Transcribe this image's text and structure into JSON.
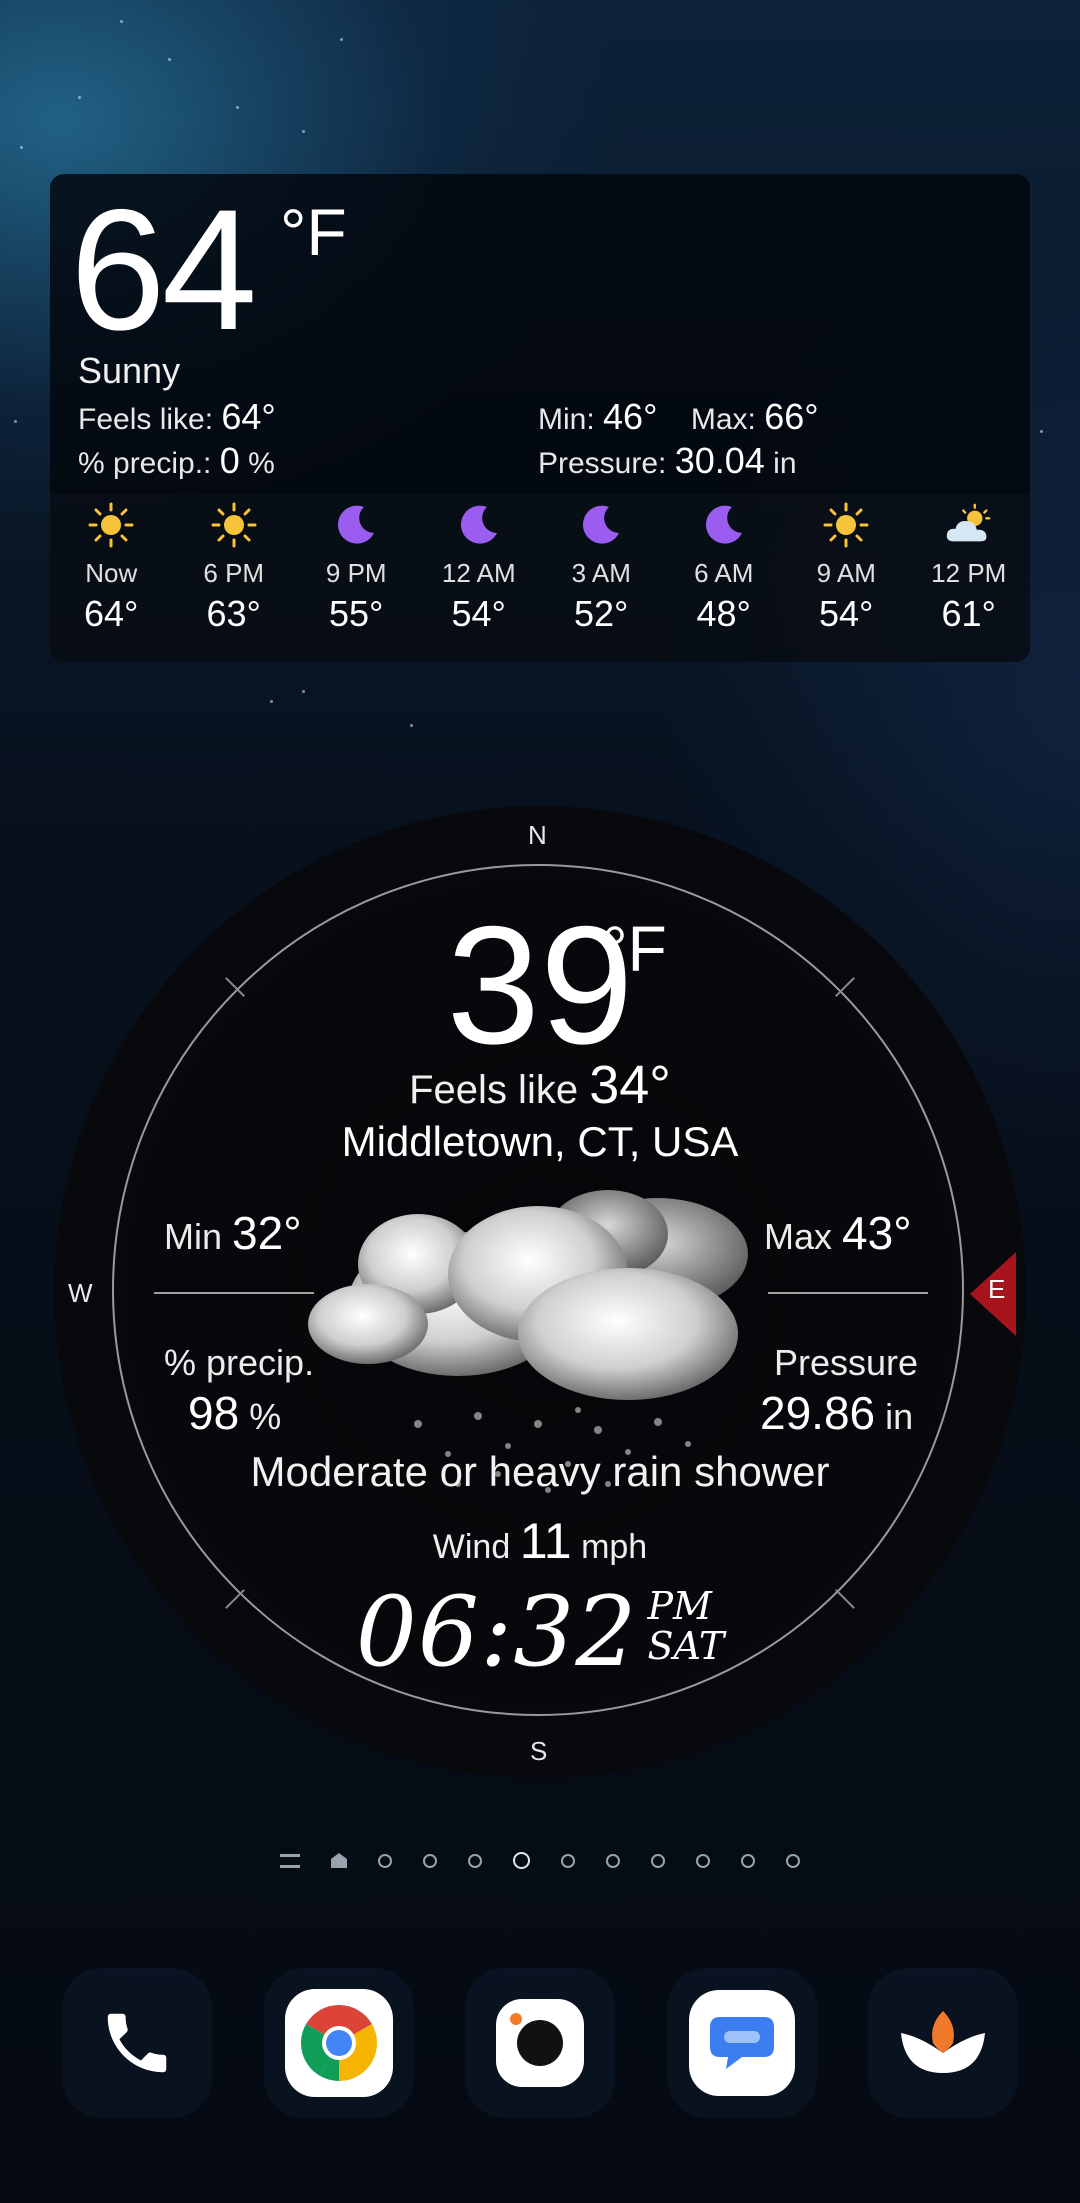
{
  "top_widget": {
    "temp": "64",
    "unit": "°F",
    "condition": "Sunny",
    "feels_label": "Feels like:",
    "feels_value": "64°",
    "precip_label": "% precip.:",
    "precip_value": "0",
    "precip_unit": "%",
    "min_label": "Min:",
    "min_value": "46°",
    "max_label": "Max:",
    "max_value": "66°",
    "pressure_label": "Pressure:",
    "pressure_value": "30.04",
    "pressure_unit": "in",
    "hourly": [
      {
        "time": "Now",
        "temp": "64°",
        "icon": "sun-icon"
      },
      {
        "time": "6 PM",
        "temp": "63°",
        "icon": "sun-icon"
      },
      {
        "time": "9 PM",
        "temp": "55°",
        "icon": "moon-icon"
      },
      {
        "time": "12 AM",
        "temp": "54°",
        "icon": "moon-icon"
      },
      {
        "time": "3 AM",
        "temp": "52°",
        "icon": "moon-icon"
      },
      {
        "time": "6 AM",
        "temp": "48°",
        "icon": "moon-icon"
      },
      {
        "time": "9 AM",
        "temp": "54°",
        "icon": "sun-icon"
      },
      {
        "time": "12 PM",
        "temp": "61°",
        "icon": "partly-cloudy-icon"
      }
    ]
  },
  "compass_widget": {
    "north": "N",
    "south": "S",
    "west": "W",
    "east": "E",
    "temp": "39",
    "unit": "°F",
    "feels_label": "Feels like",
    "feels_value": "34°",
    "location": "Middletown, CT, USA",
    "min_label": "Min",
    "min_value": "32°",
    "max_label": "Max",
    "max_value": "43°",
    "precip_label": "% precip.",
    "precip_value": "98",
    "precip_unit": "%",
    "pressure_label": "Pressure",
    "pressure_value": "29.86",
    "pressure_unit": "in",
    "description": "Moderate or heavy rain shower",
    "wind_label": "Wind",
    "wind_value": "11",
    "wind_unit": "mph",
    "time": "06:32",
    "ampm": "PM",
    "day": "SAT"
  },
  "pager": {
    "pages": 10,
    "active_index": 3
  },
  "dock": [
    {
      "name": "phone",
      "icon": "phone-icon"
    },
    {
      "name": "chrome",
      "icon": "chrome-icon"
    },
    {
      "name": "camera",
      "icon": "camera-icon"
    },
    {
      "name": "messages",
      "icon": "messages-icon"
    },
    {
      "name": "lotus",
      "icon": "lotus-icon"
    }
  ],
  "colors": {
    "sun": "#f6c33a",
    "moon": "#9b5cf0",
    "wind_marker": "#a8141b"
  }
}
